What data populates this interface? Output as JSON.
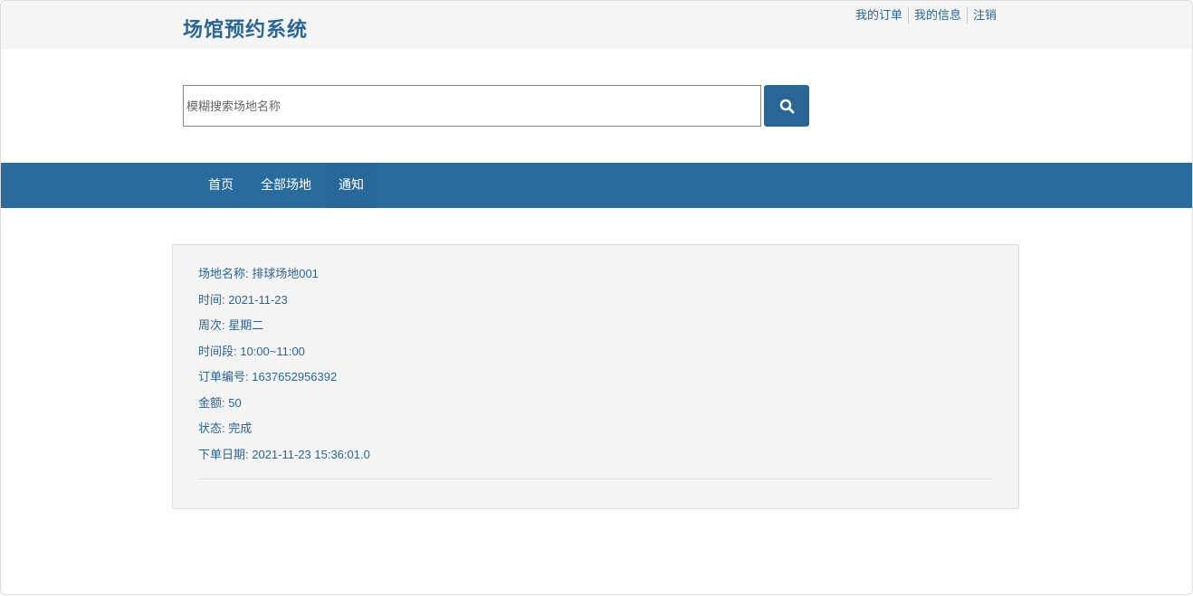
{
  "header": {
    "site_title": "场馆预约系统",
    "links": {
      "my_orders": "我的订单",
      "my_info": "我的信息",
      "logout": "注销"
    }
  },
  "search": {
    "placeholder": "模糊搜索场地名称",
    "value": "",
    "button_icon": "search-icon"
  },
  "nav": {
    "home": "首页",
    "all_venues": "全部场地",
    "notice": "通知"
  },
  "order": {
    "venue_name": "场地名称: 排球场地001",
    "date": "时间: 2021-11-23",
    "weekday": "周次: 星期二",
    "time_slot": "时间段: 10:00~11:00",
    "order_no": "订单编号: 1637652956392",
    "amount": "金额: 50",
    "status": "状态: 完成",
    "order_date": "下单日期: 2021-11-23 15:36:01.0"
  },
  "colors": {
    "brand": "#2a6597",
    "nav_background": "#2a6b9e",
    "panel_background": "#f4f4f4"
  }
}
